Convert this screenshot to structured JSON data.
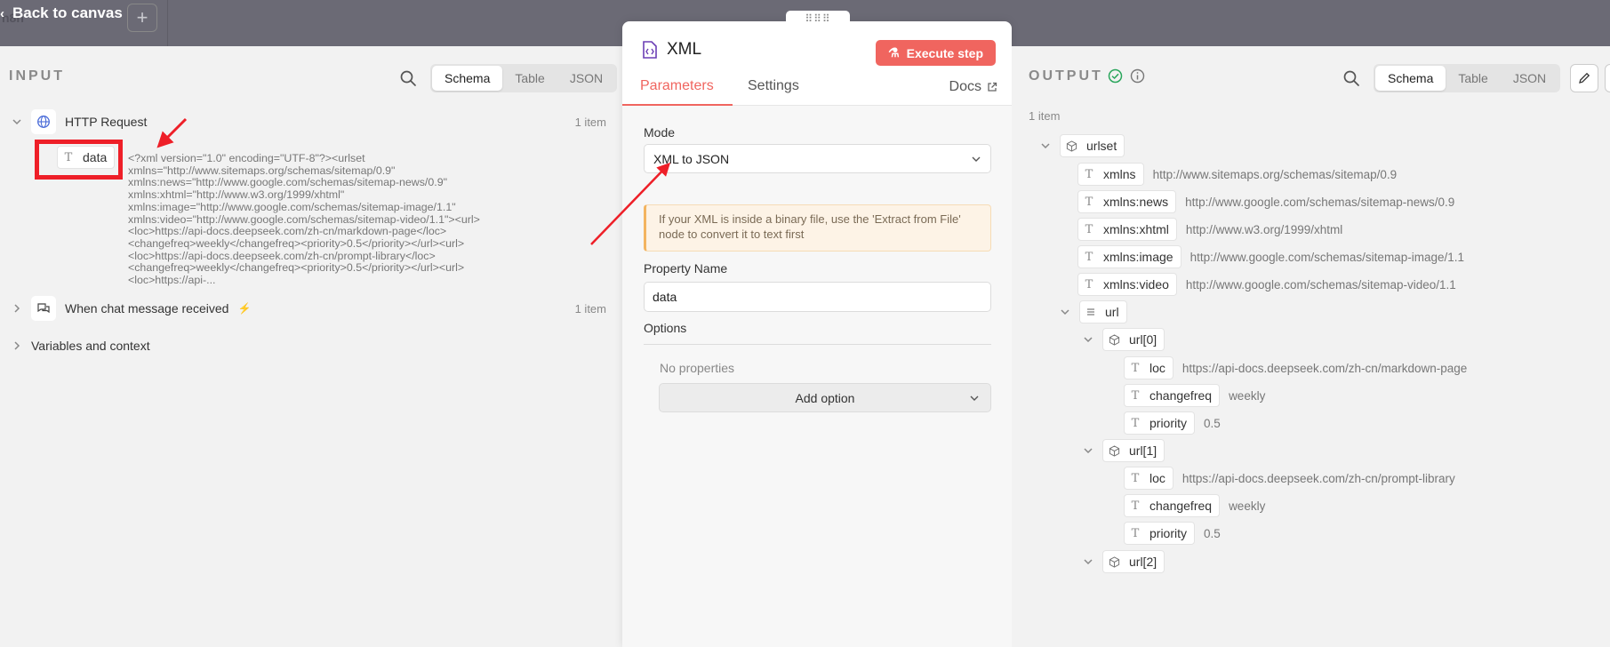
{
  "topbar": {
    "back_label": "Back to canvas",
    "logo_text": "n8n",
    "add_label": "+"
  },
  "input": {
    "title": "INPUT",
    "tabs": [
      "Schema",
      "Table",
      "JSON"
    ],
    "active_tab": "Schema",
    "nodes": [
      {
        "name": "HTTP Request",
        "count": "1 item"
      },
      {
        "name": "When chat message received",
        "count": "1 item"
      },
      {
        "name": "Variables and context"
      }
    ],
    "field": {
      "name": "data",
      "type": "T"
    },
    "xml_lines": [
      "<?xml version=\"1.0\" encoding=\"UTF-8\"?><urlset",
      "xmlns=\"http://www.sitemaps.org/schemas/sitemap/0.9\"",
      "xmlns:news=\"http://www.google.com/schemas/sitemap-news/0.9\"",
      "xmlns:xhtml=\"http://www.w3.org/1999/xhtml\"",
      "xmlns:image=\"http://www.google.com/schemas/sitemap-image/1.1\"",
      "xmlns:video=\"http://www.google.com/schemas/sitemap-video/1.1\"><url>",
      "<loc>https://api-docs.deepseek.com/zh-cn/markdown-page</loc>",
      "<changefreq>weekly</changefreq><priority>0.5</priority></url><url>",
      "<loc>https://api-docs.deepseek.com/zh-cn/prompt-library</loc>",
      "<changefreq>weekly</changefreq><priority>0.5</priority></url><url>",
      "<loc>https://api-..."
    ]
  },
  "dialog": {
    "title": "XML",
    "execute_label": "Execute step",
    "tabs": [
      "Parameters",
      "Settings"
    ],
    "active_tab": "Parameters",
    "docs_label": "Docs",
    "mode_label": "Mode",
    "mode_value": "XML to JSON",
    "notice": "If your XML is inside a binary file, use the 'Extract from File' node to convert it to text first",
    "property_label": "Property Name",
    "property_value": "data",
    "options_label": "Options",
    "no_properties": "No properties",
    "add_option": "Add option"
  },
  "output": {
    "title": "OUTPUT",
    "items": "1 item",
    "tabs": [
      "Schema",
      "Table",
      "JSON"
    ],
    "active_tab": "Schema",
    "root": "urlset",
    "attributes": [
      {
        "key": "xmlns",
        "value": "http://www.sitemaps.org/schemas/sitemap/0.9"
      },
      {
        "key": "xmlns:news",
        "value": "http://www.google.com/schemas/sitemap-news/0.9"
      },
      {
        "key": "xmlns:xhtml",
        "value": "http://www.w3.org/1999/xhtml"
      },
      {
        "key": "xmlns:image",
        "value": "http://www.google.com/schemas/sitemap-image/1.1"
      },
      {
        "key": "xmlns:video",
        "value": "http://www.google.com/schemas/sitemap-video/1.1"
      }
    ],
    "url_key": "url",
    "urls": [
      {
        "label": "url[0]",
        "fields": [
          {
            "key": "loc",
            "value": "https://api-docs.deepseek.com/zh-cn/markdown-page"
          },
          {
            "key": "changefreq",
            "value": "weekly"
          },
          {
            "key": "priority",
            "value": "0.5"
          }
        ]
      },
      {
        "label": "url[1]",
        "fields": [
          {
            "key": "loc",
            "value": "https://api-docs.deepseek.com/zh-cn/prompt-library"
          },
          {
            "key": "changefreq",
            "value": "weekly"
          },
          {
            "key": "priority",
            "value": "0.5"
          }
        ]
      },
      {
        "label": "url[2]"
      }
    ]
  },
  "colors": {
    "accent": "#f0655f",
    "annotation_red": "#ee1f28",
    "success": "#2aa65c"
  }
}
